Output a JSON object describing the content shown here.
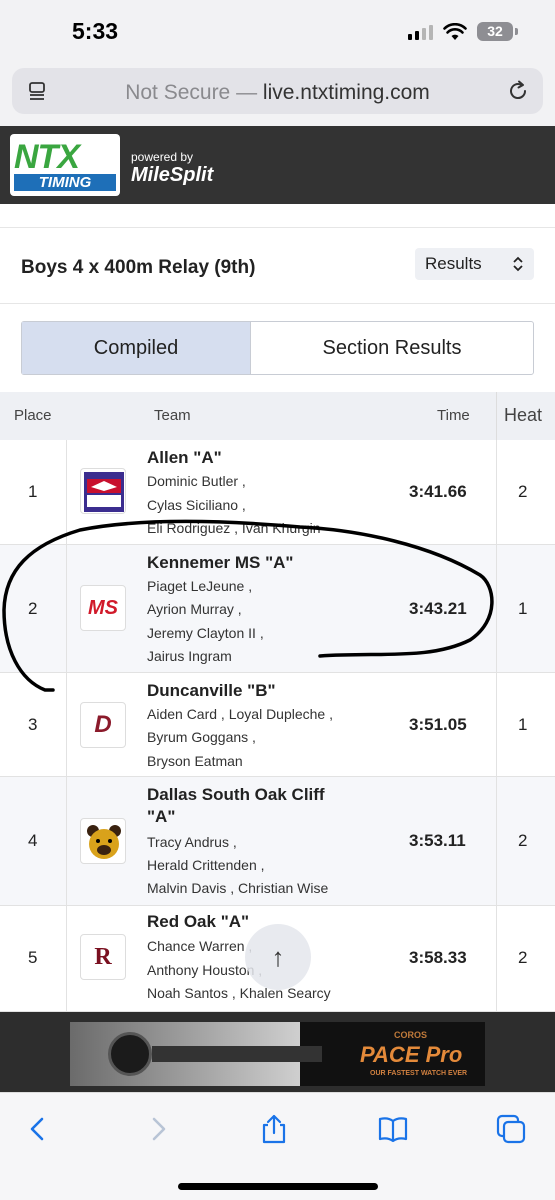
{
  "status_bar": {
    "time": "5:33",
    "battery": "32"
  },
  "browser": {
    "not_secure": "Not Secure",
    "separator": " — ",
    "domain": "live.ntxtiming.com"
  },
  "brand": {
    "logo_top": "NTX",
    "logo_bottom": "TIMING",
    "powered_by": "powered by",
    "partner": "MileSplit"
  },
  "event": {
    "title": "Boys 4 x 400m Relay (9th)",
    "view_select": "Results"
  },
  "tabs": [
    {
      "label": "Compiled",
      "active": true
    },
    {
      "label": "Section Results",
      "active": false
    }
  ],
  "table": {
    "headers": {
      "place": "Place",
      "team": "Team",
      "time": "Time",
      "heat": "Heat"
    },
    "rows": [
      {
        "place": "1",
        "team": "Allen \"A\"",
        "athletes": [
          "Dominic Butler ,",
          "Cylas Siciliano ,",
          "Eli Rodriguez ,  Ivan Khurgin"
        ],
        "time": "3:41.66",
        "heat": "2",
        "logo": "eagles-logo"
      },
      {
        "place": "2",
        "team": "Kennemer MS \"A\"",
        "athletes": [
          "Piaget LeJeune ,",
          "Ayrion Murray ,",
          "Jeremy Clayton II ,",
          "Jairus Ingram"
        ],
        "time": "3:43.21",
        "heat": "1",
        "logo": "ms-logo",
        "logo_text": "MS"
      },
      {
        "place": "3",
        "team": "Duncanville \"B\"",
        "athletes": [
          "Aiden Card ,  Loyal Dupleche ,",
          "Byrum Goggans ,",
          "Bryson Eatman"
        ],
        "time": "3:51.05",
        "heat": "1",
        "logo": "panther-logo",
        "logo_text": "D"
      },
      {
        "place": "4",
        "team": "Dallas South Oak Cliff",
        "team_line2": "\"A\"",
        "athletes": [
          "Tracy Andrus ,",
          "Herald Crittenden ,",
          "Malvin Davis ,  Christian Wise"
        ],
        "time": "3:53.11",
        "heat": "2",
        "logo": "bear-logo"
      },
      {
        "place": "5",
        "team": "Red Oak \"A\"",
        "athletes": [
          "Chance Warren ,",
          "Anthony Houston ,",
          "Noah Santos ,  Khalen Searcy"
        ],
        "time": "3:58.33",
        "heat": "2",
        "logo": "ro-logo",
        "logo_text": "R"
      }
    ]
  },
  "scroll_top_icon": "arrow-up-icon",
  "ad": {
    "brand": "COROS",
    "product": "PACE Pro",
    "tagline": "OUR FASTEST WATCH EVER"
  },
  "colors": {
    "brand_bar": "#333333",
    "ntx_green": "#3aa640",
    "timing_blue": "#1e6fb8",
    "tab_active": "#d6deef",
    "ios_blue": "#1a73e8"
  }
}
